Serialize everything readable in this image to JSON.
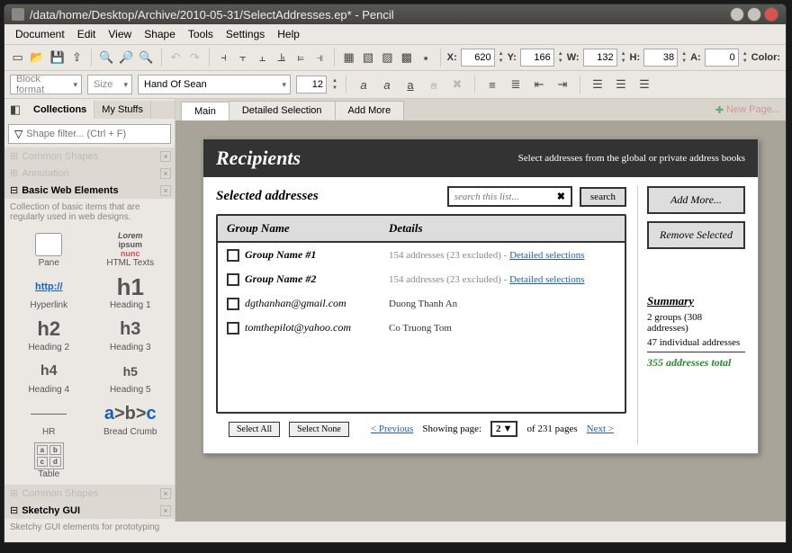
{
  "window": {
    "title": "/data/home/Desktop/Archive/2010-05-31/SelectAddresses.ep* - Pencil"
  },
  "menubar": [
    "Document",
    "Edit",
    "View",
    "Shape",
    "Tools",
    "Settings",
    "Help"
  ],
  "toolbar1": {
    "x_label": "X:",
    "x": "620",
    "y_label": "Y:",
    "y": "166",
    "w_label": "W:",
    "w": "132",
    "h_label": "H:",
    "h": "38",
    "a_label": "A:",
    "a": "0",
    "color_label": "Color:"
  },
  "toolbar2": {
    "block_format": "Block format",
    "size": "Size",
    "font": "Hand Of Sean",
    "fontsize": "12"
  },
  "left": {
    "tabs": [
      "Collections",
      "My Stuffs"
    ],
    "filter_placeholder": "Shape filter... (Ctrl + F)",
    "sections": {
      "common": "Common Shapes",
      "annotation": "Annotation",
      "basic_title": "Basic Web Elements",
      "basic_desc": "Collection of basic items that are regularly used in web designs.",
      "sketchy_title": "Sketchy GUI",
      "sketchy_desc": "Sketchy GUI elements for prototyping"
    },
    "shapes": {
      "pane": "Pane",
      "html_texts": "HTML Texts",
      "html_texts_preview1": "Lorem",
      "html_texts_preview2": "ipsum",
      "html_texts_preview3": "nunc",
      "hyperlink": "Hyperlink",
      "hyperlink_preview": "http://",
      "h1": "h1",
      "h1_label": "Heading 1",
      "h2": "h2",
      "h2_label": "Heading 2",
      "h3": "h3",
      "h3_label": "Heading 3",
      "h4": "h4",
      "h4_label": "Heading 4",
      "h5": "h5",
      "h5_label": "Heading 5",
      "hr": "HR",
      "bc": "Bread Crumb",
      "bc_a": "a",
      "bc_b": "b",
      "bc_c": "c",
      "table": "Table"
    }
  },
  "pages": {
    "tabs": [
      "Main",
      "Detailed Selection",
      "Add More"
    ],
    "new_page": "New Page..."
  },
  "doc": {
    "title": "Recipients",
    "subtitle": "Select addresses from the global or private address books",
    "selected_label": "Selected addresses",
    "search_placeholder": "search this list...",
    "search_btn": "search",
    "th_group": "Group Name",
    "th_details": "Details",
    "rows": [
      {
        "name": "Group Name #1",
        "count": "154 addresses (23 excluded) -",
        "link": "Detailed selections"
      },
      {
        "name": "Group Name #2",
        "count": "154 addresses (23 excluded) -",
        "link": "Detailed selections"
      },
      {
        "name": "dgthanhan@gmail.com",
        "count": "Duong Thanh An",
        "link": ""
      },
      {
        "name": "tomthepilot@yahoo.com",
        "count": "Co Truong Tom",
        "link": ""
      }
    ],
    "side": {
      "add_more": "Add More...",
      "remove": "Remove Selected",
      "summary": "Summary",
      "line1": "2 groups (308 addresses)",
      "line2": "47 individual addresses",
      "total": "355 addresses total"
    },
    "footer": {
      "select_all": "Select All",
      "select_none": "Select None",
      "prev": "< Previous",
      "showing": "Showing page:",
      "page": "2",
      "of": "of 231 pages",
      "next": "Next >"
    }
  }
}
